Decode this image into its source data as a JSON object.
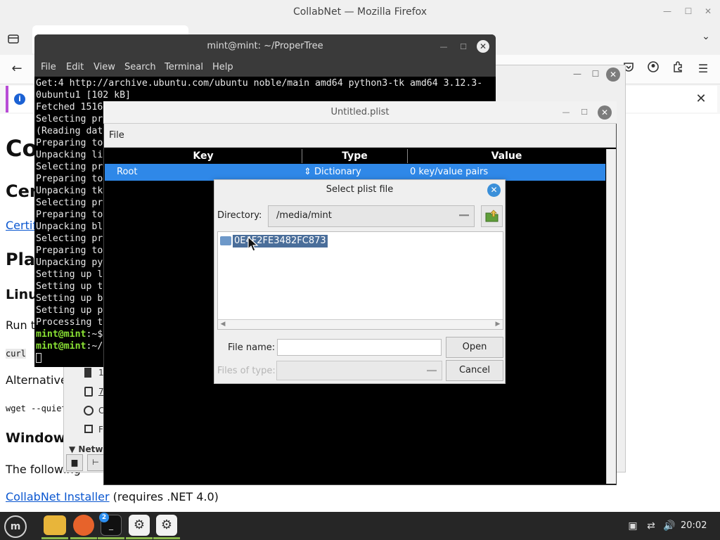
{
  "firefox": {
    "window_title": "CollabNet — Mozilla Firefox",
    "page": {
      "h1": "Co",
      "h2": "Cer",
      "cert_link": "Certif",
      "h2_platform": "Plat",
      "h3_linux": "Linu",
      "run_text": "Run t",
      "curl_code": "curl",
      "alternative_text": "Alternative",
      "wget_code": "wget --quiet",
      "h3_windows": "Windows",
      "following_text": "The following",
      "installer_link": "CollabNet Installer",
      "installer_note": " (requires .NET 4.0)"
    }
  },
  "file_manager": {
    "network_label": "Netw",
    "side_items": [
      "1",
      "7",
      "C",
      "F"
    ]
  },
  "terminal": {
    "title": "mint@mint: ~/ProperTree",
    "menu": [
      "File",
      "Edit",
      "View",
      "Search",
      "Terminal",
      "Help"
    ],
    "lines": [
      "Get:4 http://archive.ubuntu.com/ubuntu noble/main amd64 python3-tk amd64 3.12.3-",
      "0ubuntu1 [102 kB]",
      "Fetched 1516",
      "Selecting pr",
      "(Reading dat",
      "Preparing to",
      "Unpacking li",
      "Selecting pr",
      "Preparing to",
      "Unpacking tk",
      "Selecting pr",
      "Preparing to",
      "Unpacking bl",
      "Selecting pr",
      "Preparing to",
      "Unpacking py",
      "Setting up l",
      "Setting up t",
      "Setting up b",
      "Setting up p",
      "Processing t"
    ],
    "prompt1_user": "mint@mint",
    "prompt1_rest": ":~$",
    "prompt2_user": "mint@mint",
    "prompt2_rest": ":~/"
  },
  "propertree": {
    "title": "Untitled.plist",
    "menu_file": "File",
    "columns": [
      "Key",
      "Type",
      "Value"
    ],
    "root_row": {
      "key": "Root",
      "type": "⇕ Dictionary",
      "value": "0 key/value pairs"
    }
  },
  "dialog": {
    "title": "Select plist file",
    "directory_label": "Directory:",
    "directory_value": "/media/mint",
    "folder_entry": "0E4F2FE3482FC873",
    "file_name_label": "File name:",
    "file_name_value": "",
    "open_button": "Open",
    "files_of_type_label": "Files of type:",
    "cancel_button": "Cancel"
  },
  "taskbar": {
    "badge_count": "2",
    "clock": "20:02"
  }
}
